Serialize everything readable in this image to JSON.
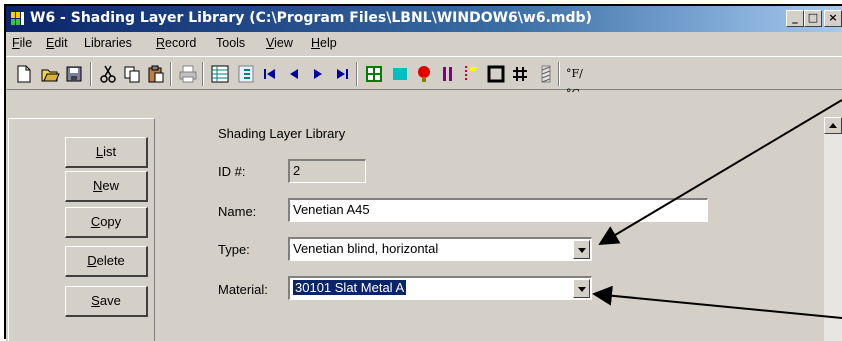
{
  "window": {
    "title": "W6 - Shading Layer Library (C:\\Program Files\\LBNL\\WINDOW6\\w6.mdb)",
    "controls": [
      "_",
      "□",
      "×"
    ]
  },
  "menu": {
    "items": [
      {
        "label": "File",
        "accel": "F",
        "rest": "ile"
      },
      {
        "label": "Edit",
        "accel": "E",
        "rest": "dit"
      },
      {
        "label": "Libraries",
        "accel": "",
        "rest": "Libraries"
      },
      {
        "label": "Record",
        "accel": "R",
        "rest": "ecord"
      },
      {
        "label": "Tools",
        "accel": "",
        "rest": "Tools"
      },
      {
        "label": "View",
        "accel": "V",
        "rest": "iew"
      },
      {
        "label": "Help",
        "accel": "H",
        "rest": "elp"
      }
    ]
  },
  "toolbar": {
    "icons": [
      "new-icon",
      "open-icon",
      "save-icon",
      "cut-icon",
      "copy-icon",
      "paste-icon",
      "print-icon",
      "list-view-icon",
      "detail-view-icon",
      "first-record-icon",
      "previous-record-icon",
      "next-record-icon",
      "last-record-icon",
      "grid-icon",
      "color-icon",
      "thermal-icon",
      "pause-icon",
      "marker-icon",
      "frame-icon",
      "hash-icon",
      "pattern-icon",
      "units-icon"
    ],
    "units_label": "°F/°C"
  },
  "buttons": {
    "list": {
      "accel": "L",
      "rest": "ist"
    },
    "new": {
      "accel": "N",
      "rest": "ew"
    },
    "copy": {
      "accel": "C",
      "rest": "opy"
    },
    "delete": {
      "accel": "D",
      "rest": "elete"
    },
    "save": {
      "accel": "S",
      "rest": "ave"
    }
  },
  "form": {
    "heading": "Shading Layer Library",
    "id_label": "ID #:",
    "id_value": "2",
    "name_label": "Name:",
    "name_value": "Venetian A45",
    "type_label": "Type:",
    "type_value": "Venetian blind, horizontal",
    "material_label": "Material:",
    "material_value": "30101 Slat Metal A"
  }
}
